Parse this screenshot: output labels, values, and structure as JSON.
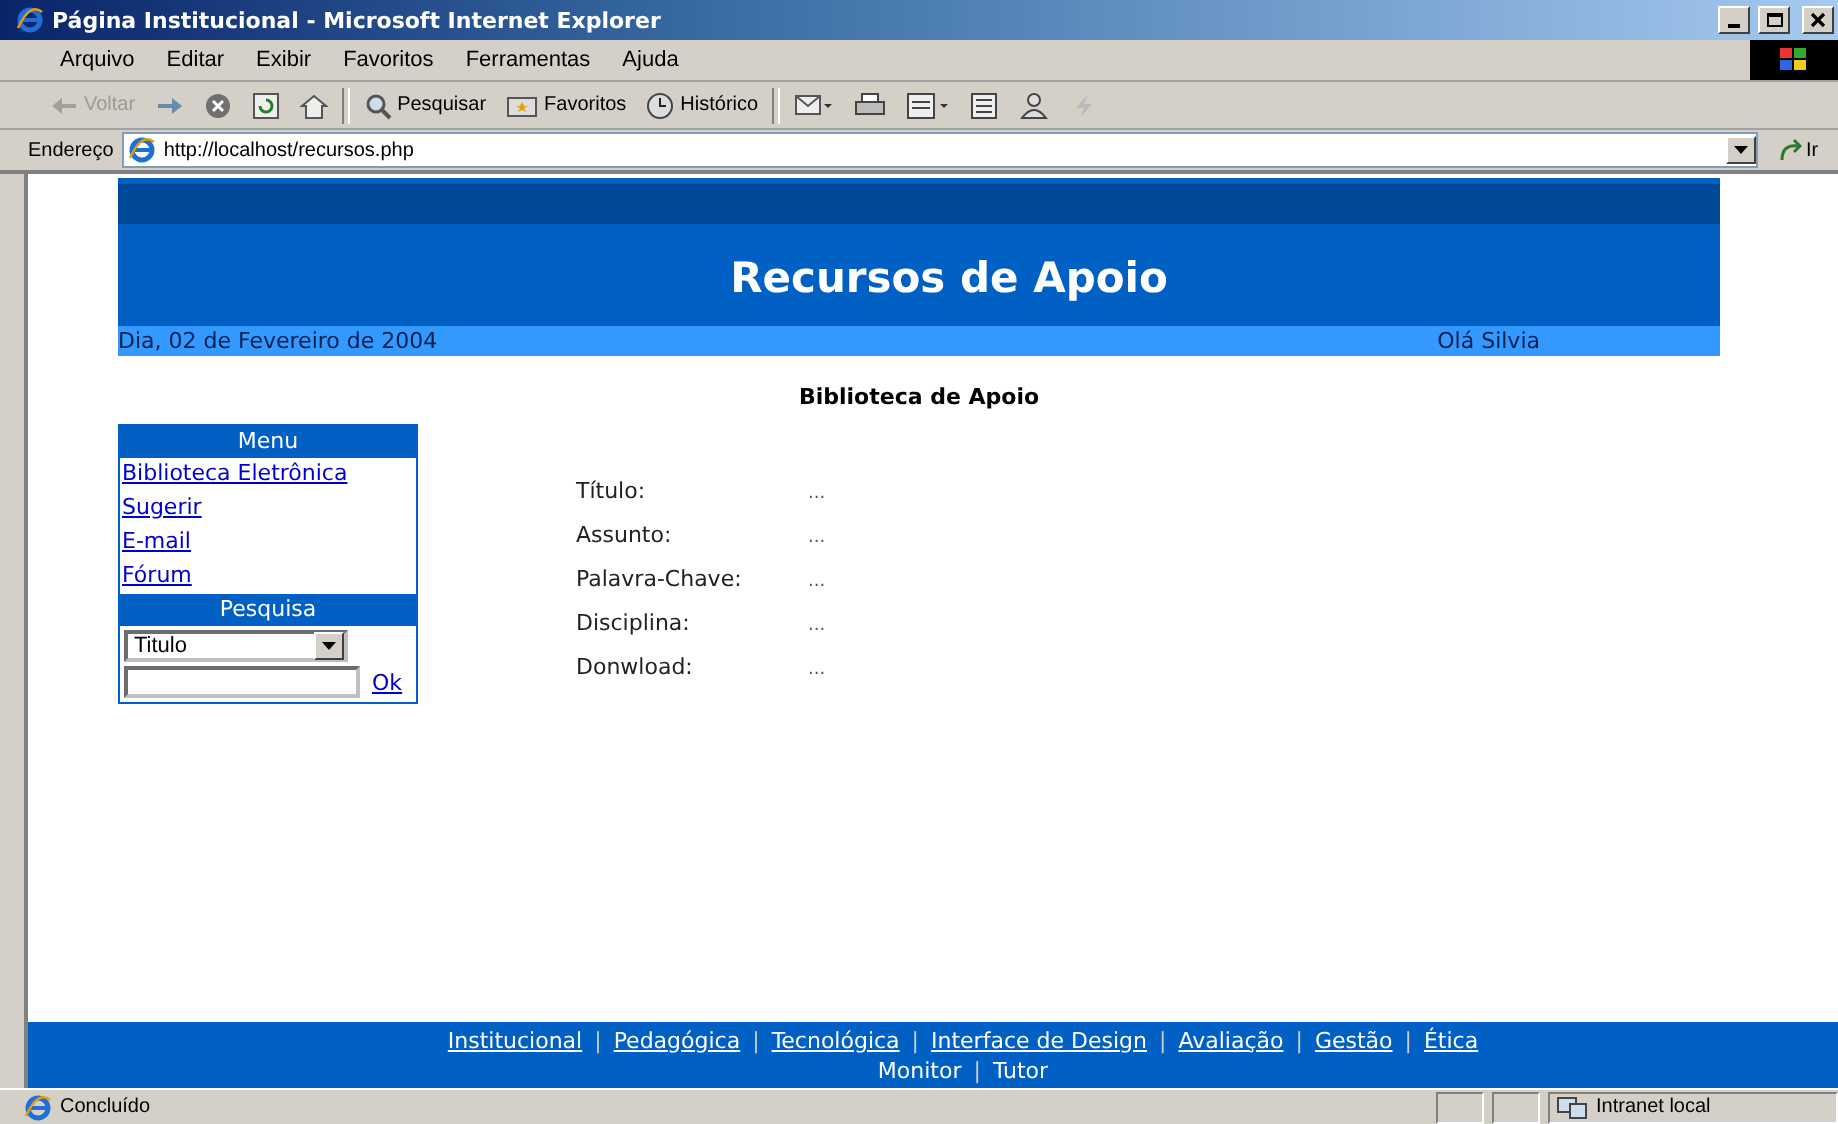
{
  "window": {
    "title": "Página Institucional - Microsoft Internet Explorer"
  },
  "menu_bar": [
    "Arquivo",
    "Editar",
    "Exibir",
    "Favoritos",
    "Ferramentas",
    "Ajuda"
  ],
  "toolbar": [
    {
      "kind": "back",
      "label": "Voltar",
      "disabled": true
    },
    {
      "kind": "forward",
      "disabled": false
    },
    {
      "kind": "stop"
    },
    {
      "kind": "refresh"
    },
    {
      "kind": "home"
    },
    {
      "kind": "search",
      "label": "Pesquisar",
      "disabled": false
    },
    {
      "kind": "favorites",
      "label": "Favoritos",
      "disabled": false
    },
    {
      "kind": "history",
      "label": "Histórico",
      "disabled": false
    },
    {
      "kind": "mail"
    },
    {
      "kind": "print"
    },
    {
      "kind": "edit"
    },
    {
      "kind": "discuss"
    },
    {
      "kind": "messenger"
    },
    {
      "kind": "flash",
      "disabled": true
    }
  ],
  "address_bar": {
    "label": "Endereço",
    "value": "http://localhost/recursos.php",
    "go": "Ir"
  },
  "page": {
    "header_title": "Recursos de Apoio",
    "date": "Dia, 02 de Fevereiro de 2004",
    "greeting": "Olá Silvia",
    "section_title": "Biblioteca de Apoio",
    "menu": {
      "title": "Menu",
      "items": [
        "Biblioteca Eletrônica",
        "Sugerir",
        "E-mail",
        "Fórum"
      ]
    },
    "search": {
      "title": "Pesquisa",
      "select_value": "Titulo",
      "button": "Ok"
    },
    "fields": [
      {
        "label": "Título:",
        "value": "..."
      },
      {
        "label": "Assunto:",
        "value": "..."
      },
      {
        "label": "Palavra-Chave:",
        "value": "..."
      },
      {
        "label": "Disciplina:",
        "value": "..."
      },
      {
        "label": "Donwload:",
        "value": "..."
      }
    ],
    "footer_separator": "|",
    "footer_links": [
      [
        "Institucional",
        "Pedagógica",
        "Tecnológica",
        "Interface de Design",
        "Avaliação",
        "Gestão",
        "Ética"
      ],
      [
        "Monitor",
        "Tutor"
      ]
    ]
  },
  "status_bar": {
    "text": "Concluído",
    "zone": "Intranet local"
  }
}
